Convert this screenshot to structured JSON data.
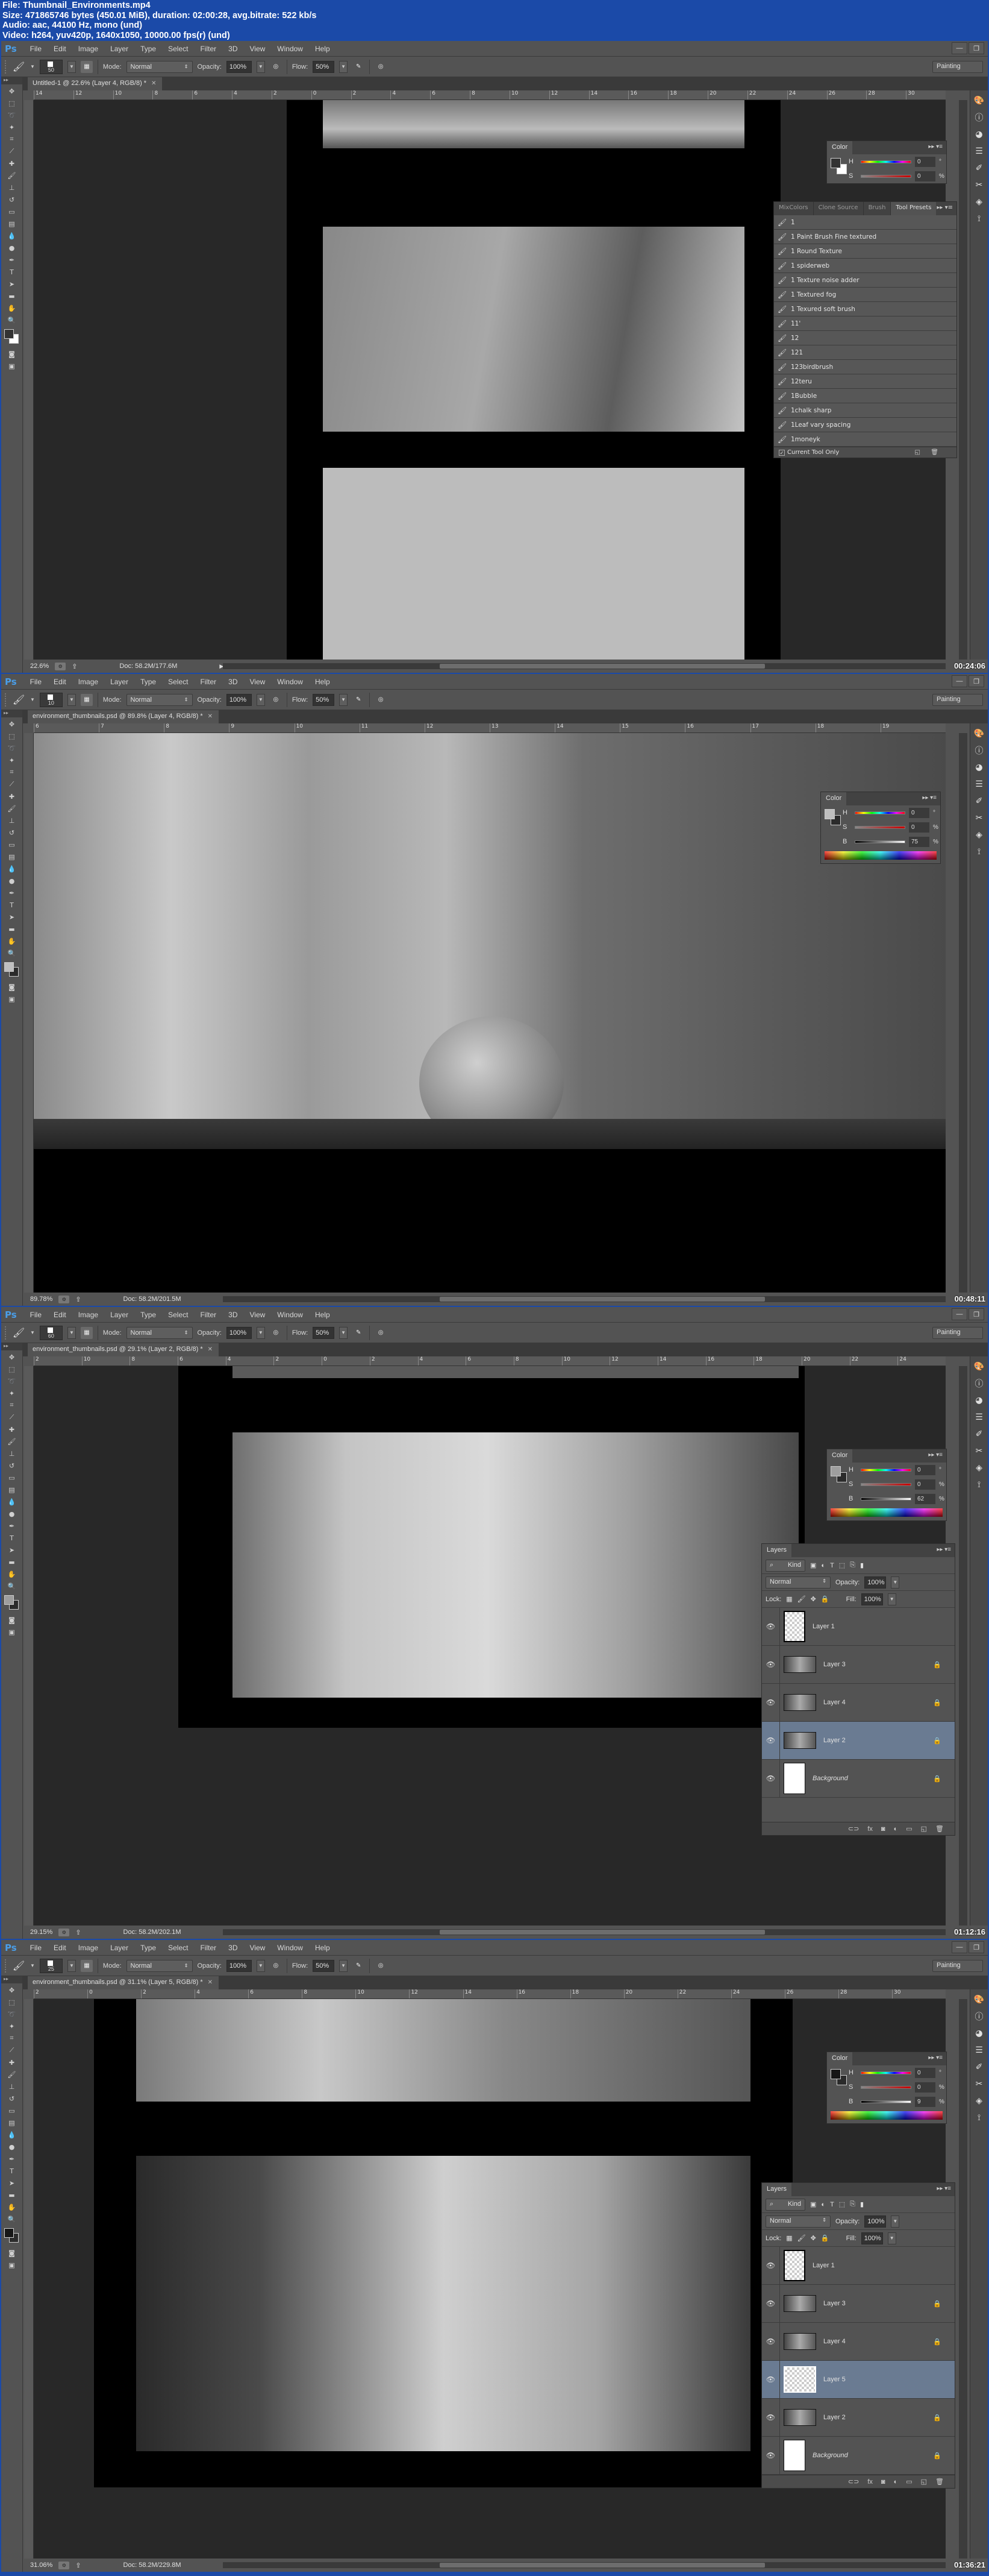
{
  "header": {
    "line1": "File: Thumbnail_Environments.mp4",
    "line2": "Size: 471865746 bytes (450.01 MiB), duration: 02:00:28, avg.bitrate: 522 kb/s",
    "line3": "Audio: aac, 44100 Hz, mono (und)",
    "line4": "Video: h264, yuv420p, 1640x1050, 10000.00 fps(r) (und)"
  },
  "app": {
    "logo": "Ps",
    "menu": [
      "File",
      "Edit",
      "Image",
      "Layer",
      "Type",
      "Select",
      "Filter",
      "3D",
      "View",
      "Window",
      "Help"
    ],
    "workspace": "Painting",
    "mode_label": "Mode:",
    "mode_value": "Normal",
    "opacity_label": "Opacity:",
    "flow_label": "Flow:",
    "window_min": "—",
    "window_restore": "❐"
  },
  "frames": [
    {
      "brush_size": "50",
      "opacity": "100%",
      "flow": "50%",
      "doc_tab": "Untitled-1 @ 22.6% (Layer 4, RGB/8) *",
      "zoom": "22.6%",
      "doc_size": "Doc: 58.2M/177.6M",
      "timestamp": "00:24:06",
      "ruler": [
        "14",
        "12",
        "10",
        "8",
        "6",
        "4",
        "2",
        "0",
        "2",
        "4",
        "6",
        "8",
        "10",
        "12",
        "14",
        "16",
        "18",
        "20",
        "22",
        "24",
        "26",
        "28",
        "30"
      ],
      "color": {
        "title": "Color",
        "h": "0",
        "s": "0",
        "b": "",
        "fg": "#333333",
        "bg": "#ffffff"
      },
      "presets": {
        "tabs": [
          "MixColors",
          "Clone Source",
          "Brush",
          "Tool Presets"
        ],
        "items": [
          "1",
          "1 Paint Brush Fine textured",
          "1 Round Texture",
          "1 spiderweb",
          "1 Texture noise adder",
          "1 Textured fog",
          "1 Texured soft brush",
          "11'",
          "12",
          "121",
          "123birdbrush",
          "12teru",
          "1Bubble",
          "1chalk sharp",
          "1Leaf  vary spacing",
          "1moneyk"
        ],
        "footer": "Current Tool Only"
      }
    },
    {
      "brush_size": "10",
      "opacity": "100%",
      "flow": "50%",
      "doc_tab": "environment_thumbnails.psd @ 89.8% (Layer 4, RGB/8) *",
      "zoom": "89.78%",
      "doc_size": "Doc: 58.2M/201.5M",
      "timestamp": "00:48:11",
      "ruler": [
        "6",
        "7",
        "8",
        "9",
        "10",
        "11",
        "12",
        "13",
        "14",
        "15",
        "16",
        "17",
        "18",
        "19"
      ],
      "color": {
        "title": "Color",
        "h": "0",
        "s": "0",
        "b": "75",
        "fg": "#bfbfbf",
        "bg": "#2b2b2b"
      }
    },
    {
      "brush_size": "60",
      "opacity": "100%",
      "flow": "50%",
      "doc_tab": "environment_thumbnails.psd @ 29.1% (Layer 2, RGB/8) *",
      "zoom": "29.15%",
      "doc_size": "Doc: 58.2M/202.1M",
      "timestamp": "01:12:16",
      "ruler": [
        "2",
        "10",
        "8",
        "6",
        "4",
        "2",
        "0",
        "2",
        "4",
        "6",
        "8",
        "10",
        "12",
        "14",
        "16",
        "18",
        "20",
        "22",
        "24"
      ],
      "color": {
        "title": "Color",
        "h": "0",
        "s": "0",
        "b": "62",
        "fg": "#9e9e9e",
        "bg": "#2b2b2b"
      },
      "layers": {
        "title": "Layers",
        "kind": "Kind",
        "blend": "Normal",
        "opacity_label": "Opacity:",
        "opacity": "100%",
        "lock_label": "Lock:",
        "fill_label": "Fill:",
        "fill": "100%",
        "items": [
          {
            "name": "Layer 1",
            "thumb": "tall",
            "locked": false,
            "selected": false
          },
          {
            "name": "Layer 3",
            "thumb": "image",
            "locked": true,
            "selected": false
          },
          {
            "name": "Layer 4",
            "thumb": "image",
            "locked": true,
            "selected": false
          },
          {
            "name": "Layer 2",
            "thumb": "image",
            "locked": true,
            "selected": true
          },
          {
            "name": "Background",
            "thumb": "white",
            "locked": true,
            "selected": false
          }
        ]
      }
    },
    {
      "brush_size": "25",
      "opacity": "100%",
      "flow": "50%",
      "doc_tab": "environment_thumbnails.psd @ 31.1% (Layer 5, RGB/8) *",
      "zoom": "31.06%",
      "doc_size": "Doc: 58.2M/229.8M",
      "timestamp": "01:36:21",
      "ruler": [
        "2",
        "0",
        "2",
        "4",
        "6",
        "8",
        "10",
        "12",
        "14",
        "16",
        "18",
        "20",
        "22",
        "24",
        "26",
        "28",
        "30"
      ],
      "color": {
        "title": "Color",
        "h": "0",
        "s": "0",
        "b": "9",
        "fg": "#171717",
        "bg": "#2b2b2b"
      },
      "layers": {
        "title": "Layers",
        "kind": "Kind",
        "blend": "Normal",
        "opacity_label": "Opacity:",
        "opacity": "100%",
        "lock_label": "Lock:",
        "fill_label": "Fill:",
        "fill": "100%",
        "items": [
          {
            "name": "Layer 1",
            "thumb": "tall",
            "locked": false,
            "selected": false
          },
          {
            "name": "Layer 3",
            "thumb": "image",
            "locked": true,
            "selected": false
          },
          {
            "name": "Layer 4",
            "thumb": "image",
            "locked": true,
            "selected": false
          },
          {
            "name": "Layer 5",
            "thumb": "checker",
            "locked": false,
            "selected": true
          },
          {
            "name": "Layer 2",
            "thumb": "image",
            "locked": true,
            "selected": false
          },
          {
            "name": "Background",
            "thumb": "white",
            "locked": true,
            "selected": false
          }
        ]
      }
    }
  ]
}
